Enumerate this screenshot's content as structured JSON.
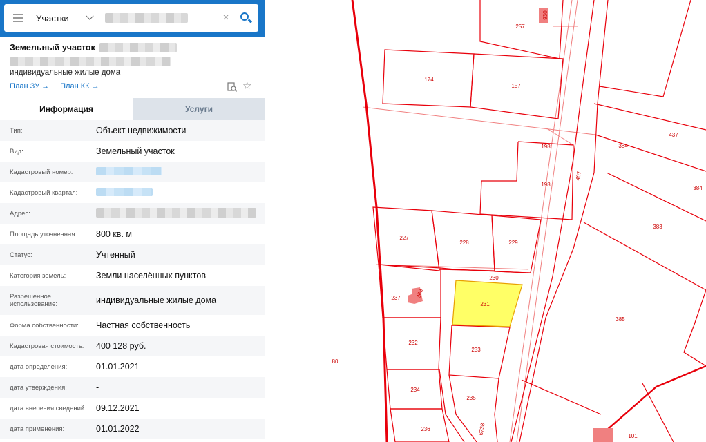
{
  "search": {
    "layer_label": "Участки",
    "query": "",
    "clear_glyph": "×",
    "collapse_glyph": "‹"
  },
  "object": {
    "title": "Земельный участок",
    "usage": "индивидуальные жилые дома",
    "plan_zu": "План ЗУ →",
    "plan_kk": "План КК →"
  },
  "tabs": {
    "info": "Информация",
    "services": "Услуги"
  },
  "info_rows": [
    {
      "label": "Тип:",
      "value": "Объект недвижимости"
    },
    {
      "label": "Вид:",
      "value": "Земельный участок"
    },
    {
      "label": "Кадастровый номер:",
      "value": ""
    },
    {
      "label": "Кадастровый квартал:",
      "value": ""
    },
    {
      "label": "Адрес:",
      "value": ""
    },
    {
      "label": "Площадь уточненная:",
      "value": "800 кв. м"
    },
    {
      "label": "Статус:",
      "value": "Учтенный"
    },
    {
      "label": "Категория земель:",
      "value": "Земли населённых пунктов"
    },
    {
      "label": "Разрешенное использование:",
      "value": "индивидуальные жилые дома"
    },
    {
      "label": "Форма собственности:",
      "value": "Частная собственность"
    },
    {
      "label": "Кадастровая стоимость:",
      "value": "400 128 руб."
    },
    {
      "label": "дата определения:",
      "value": "01.01.2021"
    },
    {
      "label": "дата утверждения:",
      "value": "-"
    },
    {
      "label": "дата внесения сведений:",
      "value": "09.12.2021"
    },
    {
      "label": "дата применения:",
      "value": "01.01.2022"
    }
  ],
  "map": {
    "parcel_labels": [
      "257",
      "930",
      "174",
      "157",
      "198",
      "198",
      "407",
      "437",
      "384",
      "384",
      "383",
      "227",
      "228",
      "229",
      "230",
      "237",
      "368",
      "231",
      "385",
      "80",
      "232",
      "233",
      "234",
      "235",
      "236",
      "6738",
      "101"
    ],
    "colors": {
      "boundary": "#e8000b",
      "thin_line": "#f08080",
      "selected_fill": "#ffff66",
      "building": "#f08080",
      "blue_bar": "#1976c8"
    }
  }
}
